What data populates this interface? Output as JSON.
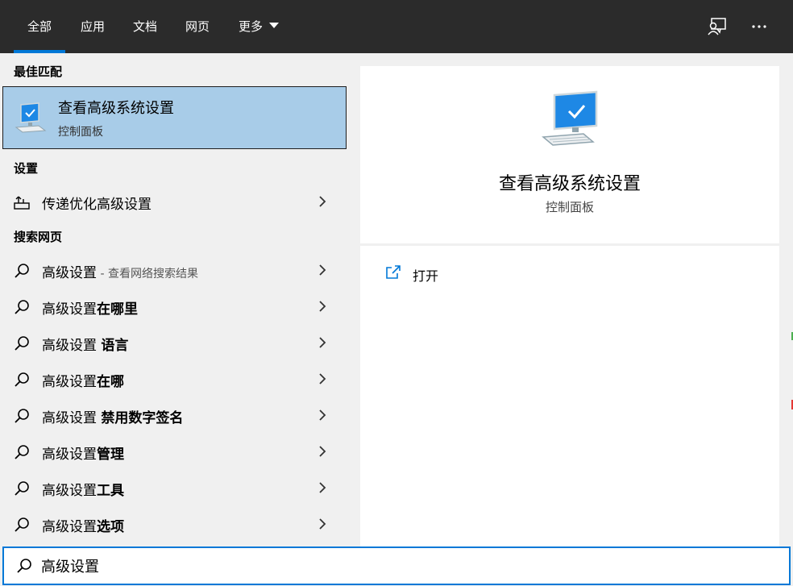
{
  "tabs": [
    {
      "label": "全部",
      "active": true
    },
    {
      "label": "应用"
    },
    {
      "label": "文档"
    },
    {
      "label": "网页"
    },
    {
      "label": "更多"
    }
  ],
  "best_match": {
    "heading": "最佳匹配",
    "title": "查看高级系统设置",
    "subtitle": "控制面板"
  },
  "settings": {
    "heading": "设置",
    "items": [
      {
        "label": "传递优化高级设置"
      }
    ]
  },
  "web": {
    "heading": "搜索网页",
    "items": [
      {
        "prefix": "高级设置",
        "bold": "",
        "sub": " - 查看网络搜索结果"
      },
      {
        "prefix": "高级设置",
        "bold": "在哪里",
        "sub": ""
      },
      {
        "prefix": "高级设置 ",
        "bold": "语言",
        "sub": ""
      },
      {
        "prefix": "高级设置",
        "bold": "在哪",
        "sub": ""
      },
      {
        "prefix": "高级设置 ",
        "bold": "禁用数字签名",
        "sub": ""
      },
      {
        "prefix": "高级设置",
        "bold": "管理",
        "sub": ""
      },
      {
        "prefix": "高级设置",
        "bold": "工具",
        "sub": ""
      },
      {
        "prefix": "高级设置",
        "bold": "选项",
        "sub": ""
      }
    ]
  },
  "preview": {
    "title": "查看高级系统设置",
    "subtitle": "控制面板",
    "actions": [
      {
        "label": "打开"
      }
    ]
  },
  "search": {
    "value": "高级设置"
  },
  "colors": {
    "accent": "#0078d7",
    "topbar": "#2b2b2b",
    "selected": "#a8cce8"
  }
}
